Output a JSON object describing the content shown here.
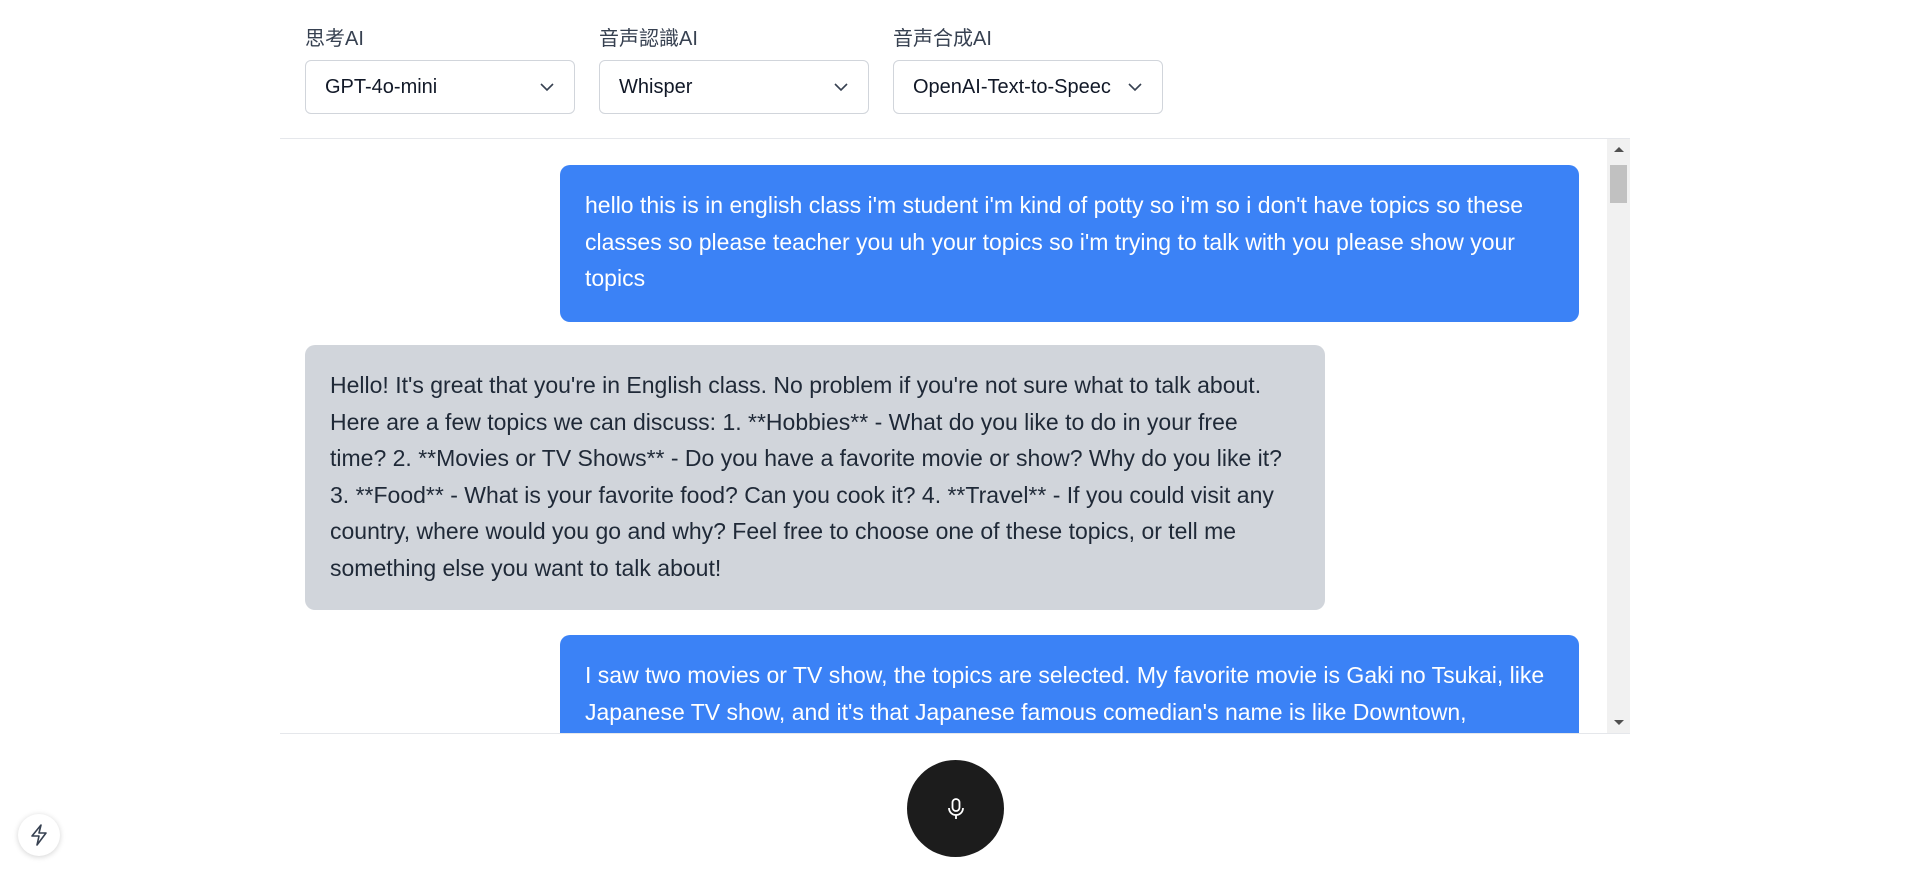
{
  "selectors": [
    {
      "label": "思考AI",
      "value": "GPT-4o-mini"
    },
    {
      "label": "音声認識AI",
      "value": "Whisper"
    },
    {
      "label": "音声合成AI",
      "value": "OpenAI-Text-to-Speec"
    }
  ],
  "messages": [
    {
      "role": "user",
      "text": "hello this is in english class i'm student i'm kind of potty so i'm so i don't have topics so these classes so please teacher you uh your topics so i'm trying to talk with you please show your topics"
    },
    {
      "role": "assistant",
      "text": "Hello! It's great that you're in English class. No problem if you're not sure what to talk about. Here are a few topics we can discuss: 1. **Hobbies** - What do you like to do in your free time? 2. **Movies or TV Shows** - Do you have a favorite movie or show? Why do you like it? 3. **Food** - What is your favorite food? Can you cook it? 4. **Travel** - If you could visit any country, where would you go and why? Feel free to choose one of these topics, or tell me something else you want to talk about!"
    },
    {
      "role": "user",
      "text": "I saw two movies or TV show, the topics are selected. My favorite movie is Gaki no Tsukai, like Japanese TV show, and it's that Japanese famous comedian's name is like Downtown,"
    }
  ],
  "icons": {
    "chevron": "chevron-down-icon",
    "mic": "microphone-icon",
    "bolt": "lightning-bolt-icon"
  },
  "colors": {
    "user_bubble": "#3b82f6",
    "assistant_bubble": "#d1d5db",
    "mic_button": "#1c1c1c"
  }
}
